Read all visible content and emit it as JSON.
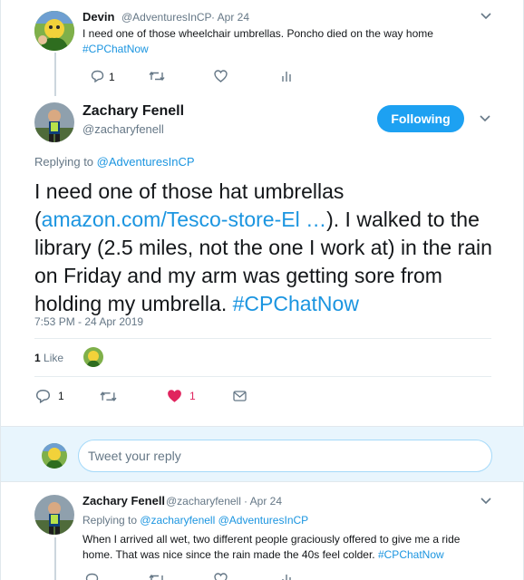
{
  "tweet1": {
    "name": "Devin",
    "handle": "@AdventuresInCP",
    "date": "· Apr 24",
    "text": "I need one of those wheelchair umbrellas. Poncho died on the way home",
    "hashtag": "#CPChatNow",
    "reply_count": "1"
  },
  "main_tweet": {
    "name": "Zachary Fenell",
    "handle": "@zacharyfenell",
    "follow_label": "Following",
    "replying_prefix": "Replying to ",
    "replying_to": "@AdventuresInCP",
    "text_before_link": "I need one of those hat umbrellas (",
    "link_text": "amazon.com/Tesco-store-El …",
    "text_after_link": "). I walked to the library (2.5 miles, not the one I work at) in the rain on Friday and my arm was getting sore from holding my umbrella. ",
    "hashtag": "#CPChatNow",
    "timestamp": "7:53 PM - 24 Apr 2019",
    "likes_count": "1",
    "likes_label": "Like",
    "reply_count": "1",
    "like_action_count": "1",
    "like_color": "#e0245e"
  },
  "reply_box": {
    "placeholder": "Tweet your reply"
  },
  "tweet3": {
    "name": "Zachary Fenell",
    "handle": "@zacharyfenell",
    "date": "· Apr 24",
    "replying_prefix": "Replying to ",
    "replying_to": "@zacharyfenell @AdventuresInCP",
    "text_line1": "When I arrived all wet, two different people graciously offered to give me a ride",
    "text_line2": "home. That was nice since the rain made the 40s feel colder. ",
    "hashtag": "#CPChatNow"
  },
  "colors": {
    "accent": "#1da1f2",
    "link": "#1b95e0",
    "muted": "#657786"
  }
}
